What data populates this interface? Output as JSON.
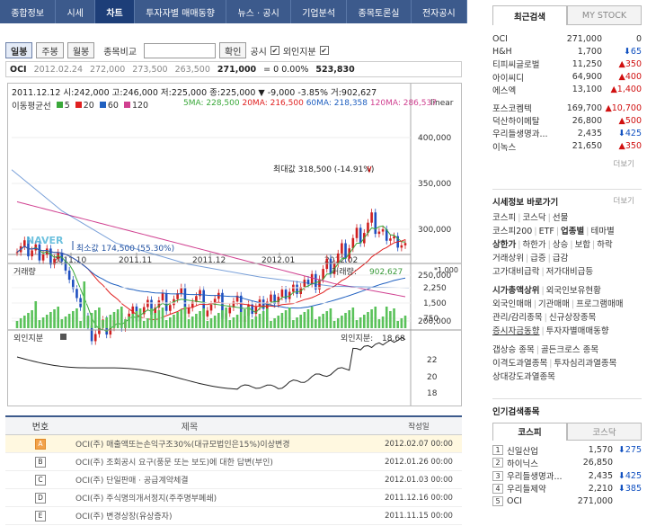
{
  "nav": [
    "종합정보",
    "시세",
    "차트",
    "투자자별 매매동향",
    "뉴스 · 공시",
    "기업분석",
    "종목토론실",
    "전자공시"
  ],
  "nav_active": 2,
  "toolbar": {
    "periods": [
      "일봉",
      "주봉",
      "월봉"
    ],
    "compare_label": "종목비교",
    "confirm": "확인",
    "disclosure": "공시",
    "foreign": "외인지분"
  },
  "quote": {
    "name": "OCI",
    "date": "2012.02.24",
    "open": "272,000",
    "high": "273,500",
    "low": "263,500",
    "close": "271,000",
    "change": "= 0 0.00%",
    "volume": "523,830"
  },
  "chart": {
    "info": "2011.12.12  시:242,000  고:246,000  저:225,000  종:225,000 ▼  -9,000  -3.85%  거:902,627",
    "scale": "linear",
    "legend_label": "이동평균선",
    "ma_periods": [
      "5",
      "20",
      "60",
      "120"
    ],
    "ma_colors": [
      "#3aa83a",
      "#e02020",
      "#2060c0",
      "#d04090"
    ],
    "ma_values": [
      "5MA: 228,500",
      "20MA: 216,500",
      "60MA: 218,358",
      "120MA: 286,537"
    ],
    "price_ticks": [
      "400,000",
      "350,000",
      "300,000",
      "250,000",
      "200,000"
    ],
    "dates": [
      "2011.10",
      "2011.11",
      "2011.12",
      "2012.01",
      "2012.02"
    ],
    "max_label": "최대값 318,500 (-14.91%)",
    "min_label": "최소값 174,500 (55.30%)",
    "volume_label": "거래량",
    "volume_value_label": "거래량:",
    "volume_value": "902,627",
    "volume_unit": "*1,000",
    "volume_ticks": [
      "2,250",
      "1,500",
      "750"
    ],
    "foreign_label": "외인지분",
    "foreign_value_label": "외인지분:",
    "foreign_value": "18.68",
    "foreign_ticks": [
      "22",
      "20",
      "18"
    ],
    "logo": "NAVER",
    "markers": [
      "H",
      "I",
      "G",
      "F",
      "E",
      "D",
      "C",
      "B",
      "A"
    ]
  },
  "board": {
    "headers": [
      "번호",
      "제목",
      "작성일"
    ],
    "rows": [
      {
        "badge": "A",
        "title": "OCI(주) 매출액또는손익구조30%(대규모법인은15%)이상변경",
        "date": "2012.02.07 00:00"
      },
      {
        "badge": "B",
        "title": "OCI(주) 조회공시 요구(풍문 또는 보도)에 대한 답변(부인)",
        "date": "2012.01.26 00:00"
      },
      {
        "badge": "C",
        "title": "OCI(주) 단일판매 · 공급계약체결",
        "date": "2012.01.03 00:00"
      },
      {
        "badge": "D",
        "title": "OCI(주) 주식명의개서정지(주주명부폐쇄)",
        "date": "2011.12.16 00:00"
      },
      {
        "badge": "E",
        "title": "OCI(주) 변경상장(유상증자)",
        "date": "2011.11.15 00:00"
      }
    ]
  },
  "side": {
    "tabs": [
      "최근검색",
      "MY STOCK"
    ],
    "recent": [
      {
        "name": "OCI",
        "price": "271,000",
        "change": "0",
        "dir": "none"
      },
      {
        "name": "H&H",
        "price": "1,700",
        "change": "65",
        "dir": "dn"
      },
      {
        "name": "티피씨글로벌",
        "price": "11,250",
        "change": "350",
        "dir": "up"
      },
      {
        "name": "아이씨디",
        "price": "64,900",
        "change": "400",
        "dir": "up"
      },
      {
        "name": "에스엑",
        "price": "13,100",
        "change": "1,400",
        "dir": "up"
      },
      {
        "name": "포스코켐텍",
        "price": "169,700",
        "change": "10,700",
        "dir": "up"
      },
      {
        "name": "덕산하이메탈",
        "price": "26,800",
        "change": "500",
        "dir": "up"
      },
      {
        "name": "우리들생명과...",
        "price": "2,435",
        "change": "425",
        "dir": "dn"
      },
      {
        "name": "이녹스",
        "price": "21,650",
        "change": "350",
        "dir": "up"
      }
    ],
    "more": "더보기",
    "shortcut_title": "시세정보 바로가기",
    "shortcut_more": "더보기",
    "shortcuts": [
      [
        "코스피",
        "코스닥",
        "선물"
      ],
      [
        "코스피200",
        "ETF",
        "업종별",
        "테마별"
      ],
      [
        "상한가",
        "하한가",
        "상승",
        "보합",
        "하락"
      ],
      [
        "거래상위",
        "급증",
        "급감"
      ],
      [
        "고가대비급락",
        "저가대비급등"
      ],
      [
        "시가총액상위",
        "외국인보유현황"
      ],
      [
        "외국인매매",
        "기관매매",
        "프로그램매매"
      ],
      [
        "관리/감리종목",
        "신규상장종목"
      ],
      [
        "증시자금동향",
        "투자자별매매동향"
      ],
      [
        "갭상승 종목",
        "골든크로스 종목"
      ],
      [
        "이격도과열종목",
        "투자심리과열종목"
      ],
      [
        "상대강도과열종목"
      ]
    ],
    "popular_title": "인기검색종목",
    "popular_tabs": [
      "코스피",
      "코스닥"
    ],
    "popular": [
      {
        "rank": "1",
        "name": "신일산업",
        "price": "1,570",
        "change": "275",
        "dir": "dn"
      },
      {
        "rank": "2",
        "name": "하이닉스",
        "price": "26,850",
        "change": "",
        "dir": "none"
      },
      {
        "rank": "3",
        "name": "우리들생명과...",
        "price": "2,435",
        "change": "425",
        "dir": "dn"
      },
      {
        "rank": "4",
        "name": "우리들제약",
        "price": "2,210",
        "change": "385",
        "dir": "dn"
      },
      {
        "rank": "5",
        "name": "OCI",
        "price": "271,000",
        "change": "",
        "dir": "none"
      }
    ]
  }
}
